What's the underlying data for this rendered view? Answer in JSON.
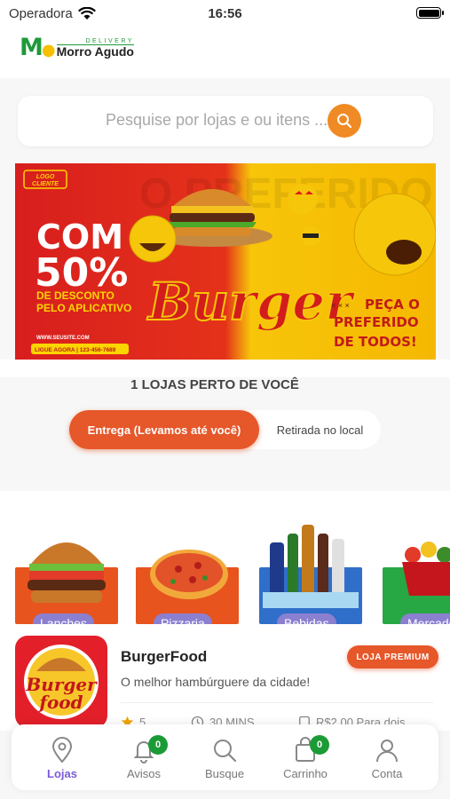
{
  "status_bar": {
    "carrier": "Operadora",
    "time": "16:56"
  },
  "header": {
    "logo_sub": "DELIVERY",
    "logo_main": "Morro Agudo"
  },
  "search": {
    "placeholder": "Pesquise por lojas e ou itens ..."
  },
  "banner": {
    "logo_line1": "LOGO",
    "logo_line2": "CLIENTE",
    "headline_1": "COM",
    "headline_2": "50%",
    "desc_1": "DE DESCONTO",
    "desc_2": "PELO APLICATIVO",
    "title": "Burger",
    "cta_1": "PEÇA O",
    "cta_2": "PREFERIDO",
    "cta_3": "DE TODOS!",
    "site": "WWW.SEUSITE.COM",
    "phone": "LIGUE AGORA | 123-456-7689",
    "bg_text": "O PREFERIDO"
  },
  "stores_count": "1 LOJAS PERTO DE VOCÊ",
  "delivery_toggle": {
    "active": "Entrega (Levamos até você)",
    "inactive": "Retirada no local"
  },
  "categories": [
    {
      "label": "Lanches",
      "color": "#e8541e"
    },
    {
      "label": "Pizzaria",
      "color": "#e8541e"
    },
    {
      "label": "Bebidas",
      "color": "#2f6fc9"
    },
    {
      "label": "Mercado",
      "color": "#28a745"
    }
  ],
  "store": {
    "name": "BurgerFood",
    "description": "O melhor hambúrguere da cidade!",
    "badge": "LOJA PREMIUM",
    "logo_line1": "Burger",
    "logo_line2": "food",
    "rating": "5",
    "time": "30 MINS",
    "fee": "R$2,00 Para dois"
  },
  "bottom_nav": [
    {
      "label": "Lojas",
      "icon": "location-pin-icon",
      "active": true
    },
    {
      "label": "Avisos",
      "icon": "bell-icon",
      "badge": "0"
    },
    {
      "label": "Busque",
      "icon": "search-icon"
    },
    {
      "label": "Carrinho",
      "icon": "shopping-bag-icon",
      "badge": "0"
    },
    {
      "label": "Conta",
      "icon": "user-icon"
    }
  ],
  "colors": {
    "accent_orange": "#e6572a",
    "search_orange": "#f08a24",
    "active_nav": "#7b5bd6",
    "badge_green": "#1b9b36",
    "brand_green": "#1f9a3a"
  }
}
